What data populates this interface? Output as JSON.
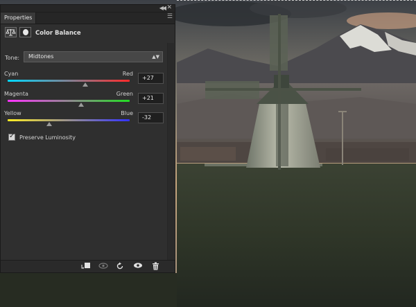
{
  "panel": {
    "tab_label": "Properties",
    "adjustment_title": "Color Balance",
    "collapse_icon": "double-chevron-icon",
    "close_icon": "close-icon",
    "menu_icon": "panel-menu-icon"
  },
  "tone": {
    "label": "Tone:",
    "selected": "Midtones"
  },
  "sliders": [
    {
      "left": "Cyan",
      "right": "Red",
      "value": "+27",
      "level": 27,
      "min": -100,
      "max": 100
    },
    {
      "left": "Magenta",
      "right": "Green",
      "value": "+21",
      "level": 21,
      "min": -100,
      "max": 100
    },
    {
      "left": "Yellow",
      "right": "Blue",
      "value": "-32",
      "level": -32,
      "min": -100,
      "max": 100
    }
  ],
  "preserve_luminosity": {
    "label": "Preserve Luminosity",
    "checked": true
  },
  "footer_icons": [
    "clip-to-layer-icon",
    "view-previous-state-icon",
    "reset-icon",
    "visibility-eye-icon",
    "trash-icon"
  ]
}
